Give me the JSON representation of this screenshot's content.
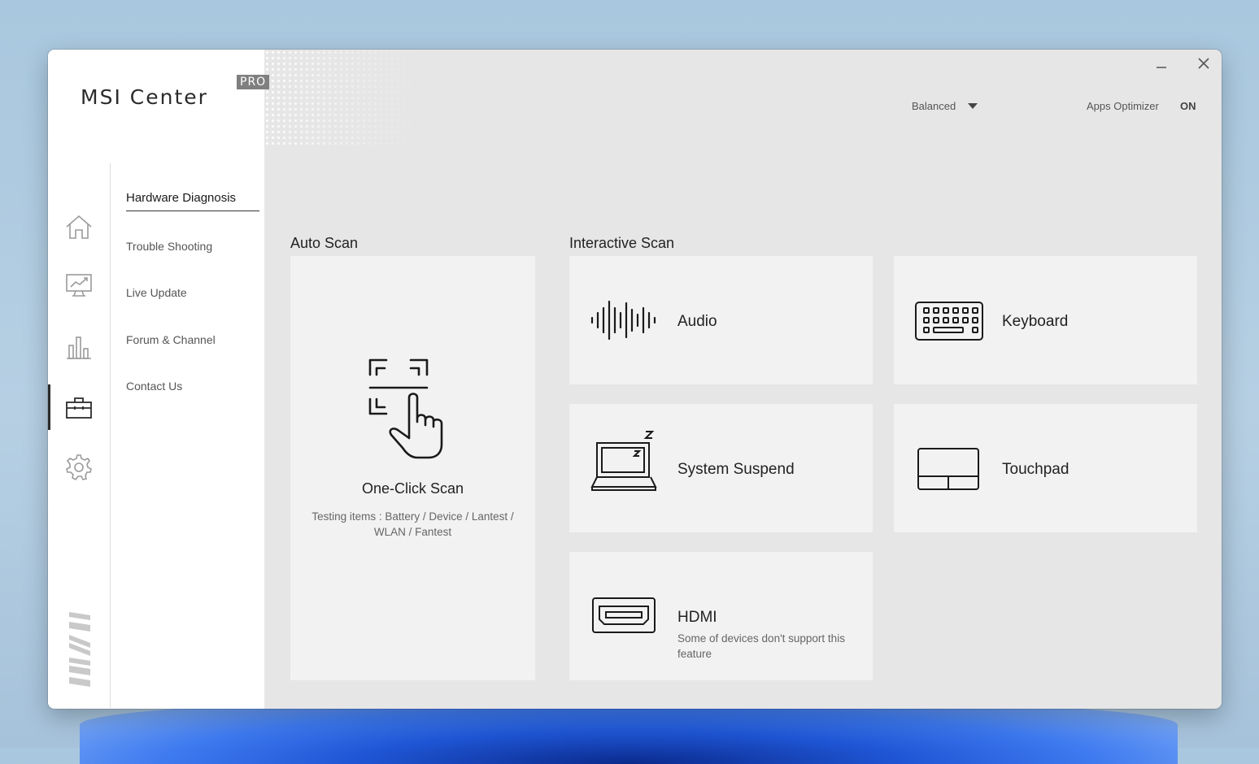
{
  "app": {
    "title": "MSI Center",
    "edition_badge": "PRO"
  },
  "window_controls": {
    "minimize_icon": "minimize-icon",
    "close_icon": "close-icon"
  },
  "topbar": {
    "mode_select": "Balanced",
    "apps_optimizer_label": "Apps Optimizer",
    "apps_optimizer_state": "ON"
  },
  "rail": {
    "items": [
      {
        "icon": "home-icon"
      },
      {
        "icon": "monitor-chart-icon"
      },
      {
        "icon": "bar-chart-icon"
      },
      {
        "icon": "toolbox-icon",
        "active": true
      },
      {
        "icon": "gear-icon"
      }
    ],
    "brand_icon": "msi-logo"
  },
  "subnav": {
    "items": [
      {
        "label": "Hardware Diagnosis",
        "active": true
      },
      {
        "label": "Trouble Shooting"
      },
      {
        "label": "Live Update"
      },
      {
        "label": "Forum & Channel"
      },
      {
        "label": "Contact Us"
      }
    ]
  },
  "main": {
    "auto_scan": {
      "title": "Auto Scan",
      "card": {
        "label": "One-Click Scan",
        "description": "Testing items : Battery / Device / Lantest / WLAN / Fantest",
        "icon": "touch-scan-icon"
      }
    },
    "interactive_scan": {
      "title": "Interactive Scan",
      "cards": [
        {
          "label": "Audio",
          "icon": "audio-wave-icon"
        },
        {
          "label": "Keyboard",
          "icon": "keyboard-icon"
        },
        {
          "label": "System Suspend",
          "icon": "laptop-sleep-icon"
        },
        {
          "label": "Touchpad",
          "icon": "touchpad-icon"
        },
        {
          "label": "HDMI",
          "description": "Some of devices don't support this feature",
          "icon": "hdmi-icon"
        }
      ]
    }
  },
  "colors": {
    "window_bg": "#e6e6e6",
    "card_bg": "#f2f2f2",
    "sidebar_bg": "#ffffff",
    "text_primary": "#222222",
    "text_secondary": "#666666"
  }
}
